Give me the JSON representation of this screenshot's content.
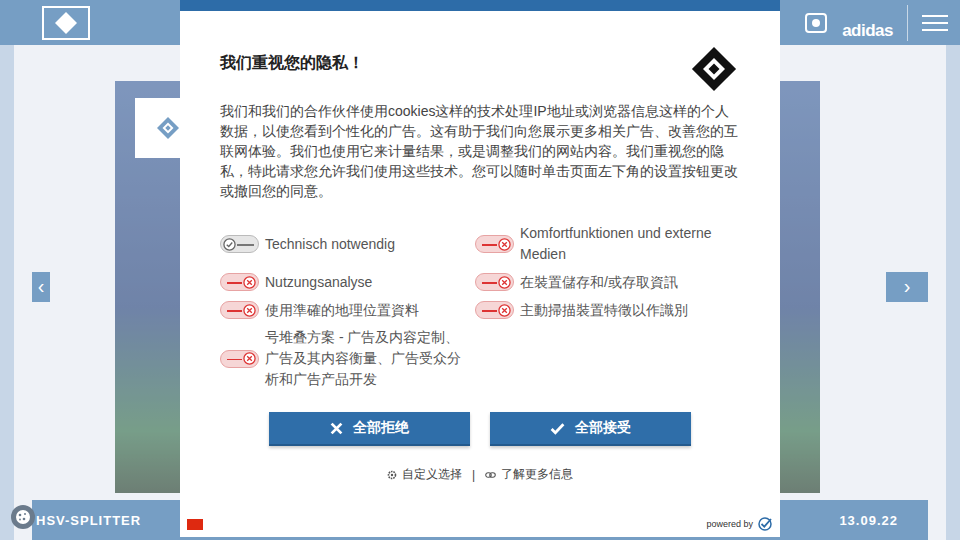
{
  "header": {
    "brand": "adidas"
  },
  "carousel": {
    "prev": "‹",
    "next": "›",
    "caption": "HSV-SPLITTER",
    "date": "13.09.22"
  },
  "consent": {
    "title": "我们重视您的隐私！",
    "body": "我们和我们的合作伙伴使用cookies这样的技术处理IP地址或浏览器信息这样的个人数据，以使您看到个性化的广告。这有助于我们向您展示更多相关广告、改善您的互联网体验。我们也使用它来计量结果，或是调整我们的网站内容。我们重视您的隐私，特此请求您允许我们使用这些技术。您可以随时单击页面左下角的设置按钮更改或撤回您的同意。",
    "toggles": [
      {
        "label": "Technisch notwendig",
        "kind": "locked",
        "on": true
      },
      {
        "label": "Komfortfunktionen und externe Medien",
        "kind": "switch",
        "on": false
      },
      {
        "label": "Nutzungsanalyse",
        "kind": "switch",
        "on": false
      },
      {
        "label": "在裝置儲存和/或存取資訊",
        "kind": "switch",
        "on": false
      },
      {
        "label": "使用準確的地理位置資料",
        "kind": "switch",
        "on": false
      },
      {
        "label": "主動掃描裝置特徵以作識別",
        "kind": "switch",
        "on": false
      },
      {
        "label": "号堆叠方案 - 广告及内容定制、广告及其内容衡量、广告受众分析和广告产品开发",
        "kind": "switch",
        "on": false
      }
    ],
    "buttons": [
      {
        "label": "全部拒绝",
        "kind": "reject"
      },
      {
        "label": "全部接受",
        "kind": "accept"
      }
    ],
    "links": [
      {
        "label": "自定义选择",
        "kind": "settings"
      },
      {
        "label": "了解更多信息",
        "kind": "info"
      }
    ],
    "separator": "|",
    "powered": "powered by"
  }
}
